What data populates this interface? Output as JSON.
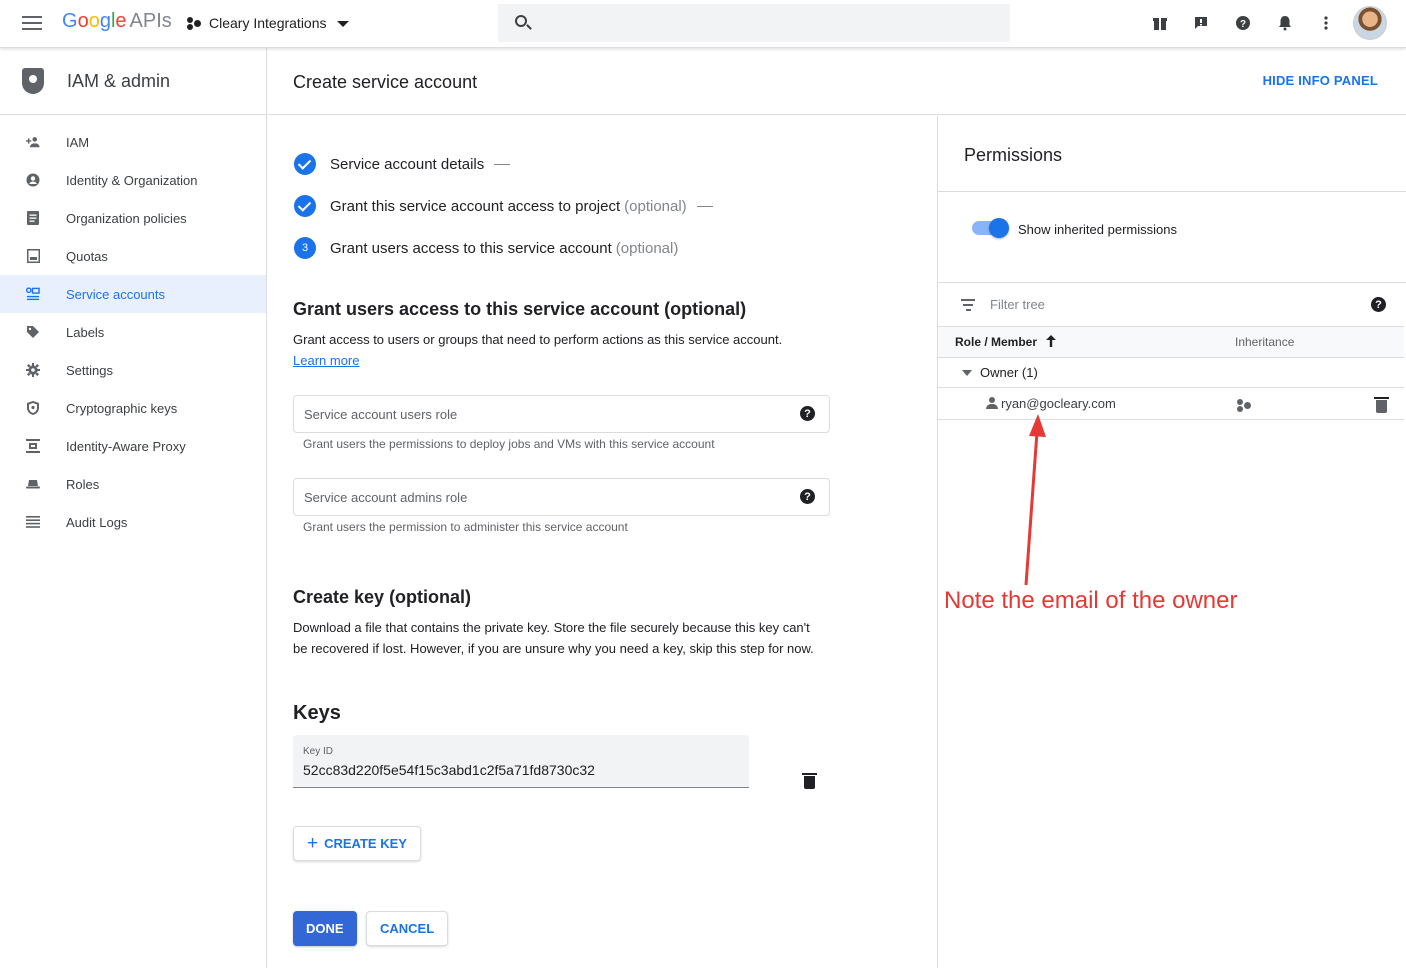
{
  "topbar": {
    "brand_google": [
      "G",
      "o",
      "o",
      "g",
      "l",
      "e"
    ],
    "brand_apis": "APIs",
    "project_name": "Cleary Integrations",
    "icons": [
      "gift-icon",
      "feedback-icon",
      "help-icon",
      "notifications-icon",
      "more-vert-icon"
    ]
  },
  "sidebar": {
    "title": "IAM & admin",
    "items": [
      {
        "label": "IAM",
        "icon": "person-add-icon"
      },
      {
        "label": "Identity & Organization",
        "icon": "account-circle-icon"
      },
      {
        "label": "Organization policies",
        "icon": "policy-document-icon"
      },
      {
        "label": "Quotas",
        "icon": "quota-icon"
      },
      {
        "label": "Service accounts",
        "icon": "service-account-icon",
        "active": true
      },
      {
        "label": "Labels",
        "icon": "label-icon"
      },
      {
        "label": "Settings",
        "icon": "settings-icon"
      },
      {
        "label": "Cryptographic keys",
        "icon": "shield-key-icon"
      },
      {
        "label": "Identity-Aware Proxy",
        "icon": "proxy-icon"
      },
      {
        "label": "Roles",
        "icon": "hat-icon"
      },
      {
        "label": "Audit Logs",
        "icon": "list-icon"
      }
    ]
  },
  "header": {
    "page_title": "Create service account",
    "hide_info_panel": "HIDE INFO PANEL"
  },
  "steps": {
    "step1": "Service account details",
    "step2": "Grant this service account access to project",
    "step2_opt": "(optional)",
    "step3_num": "3",
    "step3": "Grant users access to this service account",
    "step3_opt": "(optional)"
  },
  "grant_section": {
    "heading": "Grant users access to this service account (optional)",
    "description": "Grant access to users or groups that need to perform actions as this service account.",
    "learn_more": "Learn more",
    "users_role_placeholder": "Service account users role",
    "users_role_hint": "Grant users the permissions to deploy jobs and VMs with this service account",
    "admins_role_placeholder": "Service account admins role",
    "admins_role_hint": "Grant users the permission to administer this service account"
  },
  "key_section": {
    "heading": "Create key (optional)",
    "description": "Download a file that contains the private key. Store the file securely because this key can't be recovered if lost. However, if you are unsure why you need a key, skip this step for now.",
    "keys_heading": "Keys",
    "key_id_label": "Key ID",
    "key_id_value": "52cc83d220f5e54f15c3abd1c2f5a71fd8730c32",
    "create_key": "CREATE KEY"
  },
  "actions": {
    "done": "DONE",
    "cancel": "CANCEL"
  },
  "permissions": {
    "title": "Permissions",
    "show_inherited": "Show inherited permissions",
    "show_inherited_on": true,
    "filter_placeholder": "Filter tree",
    "col_role_member": "Role / Member",
    "col_inheritance": "Inheritance",
    "owner_group": "Owner (1)",
    "member_email": "ryan@gocleary.com"
  },
  "annotation": {
    "text": "Note the email of the owner",
    "color": "#e53935"
  },
  "colors": {
    "accent": "#1a73e8",
    "primary_button": "#3367d6"
  }
}
